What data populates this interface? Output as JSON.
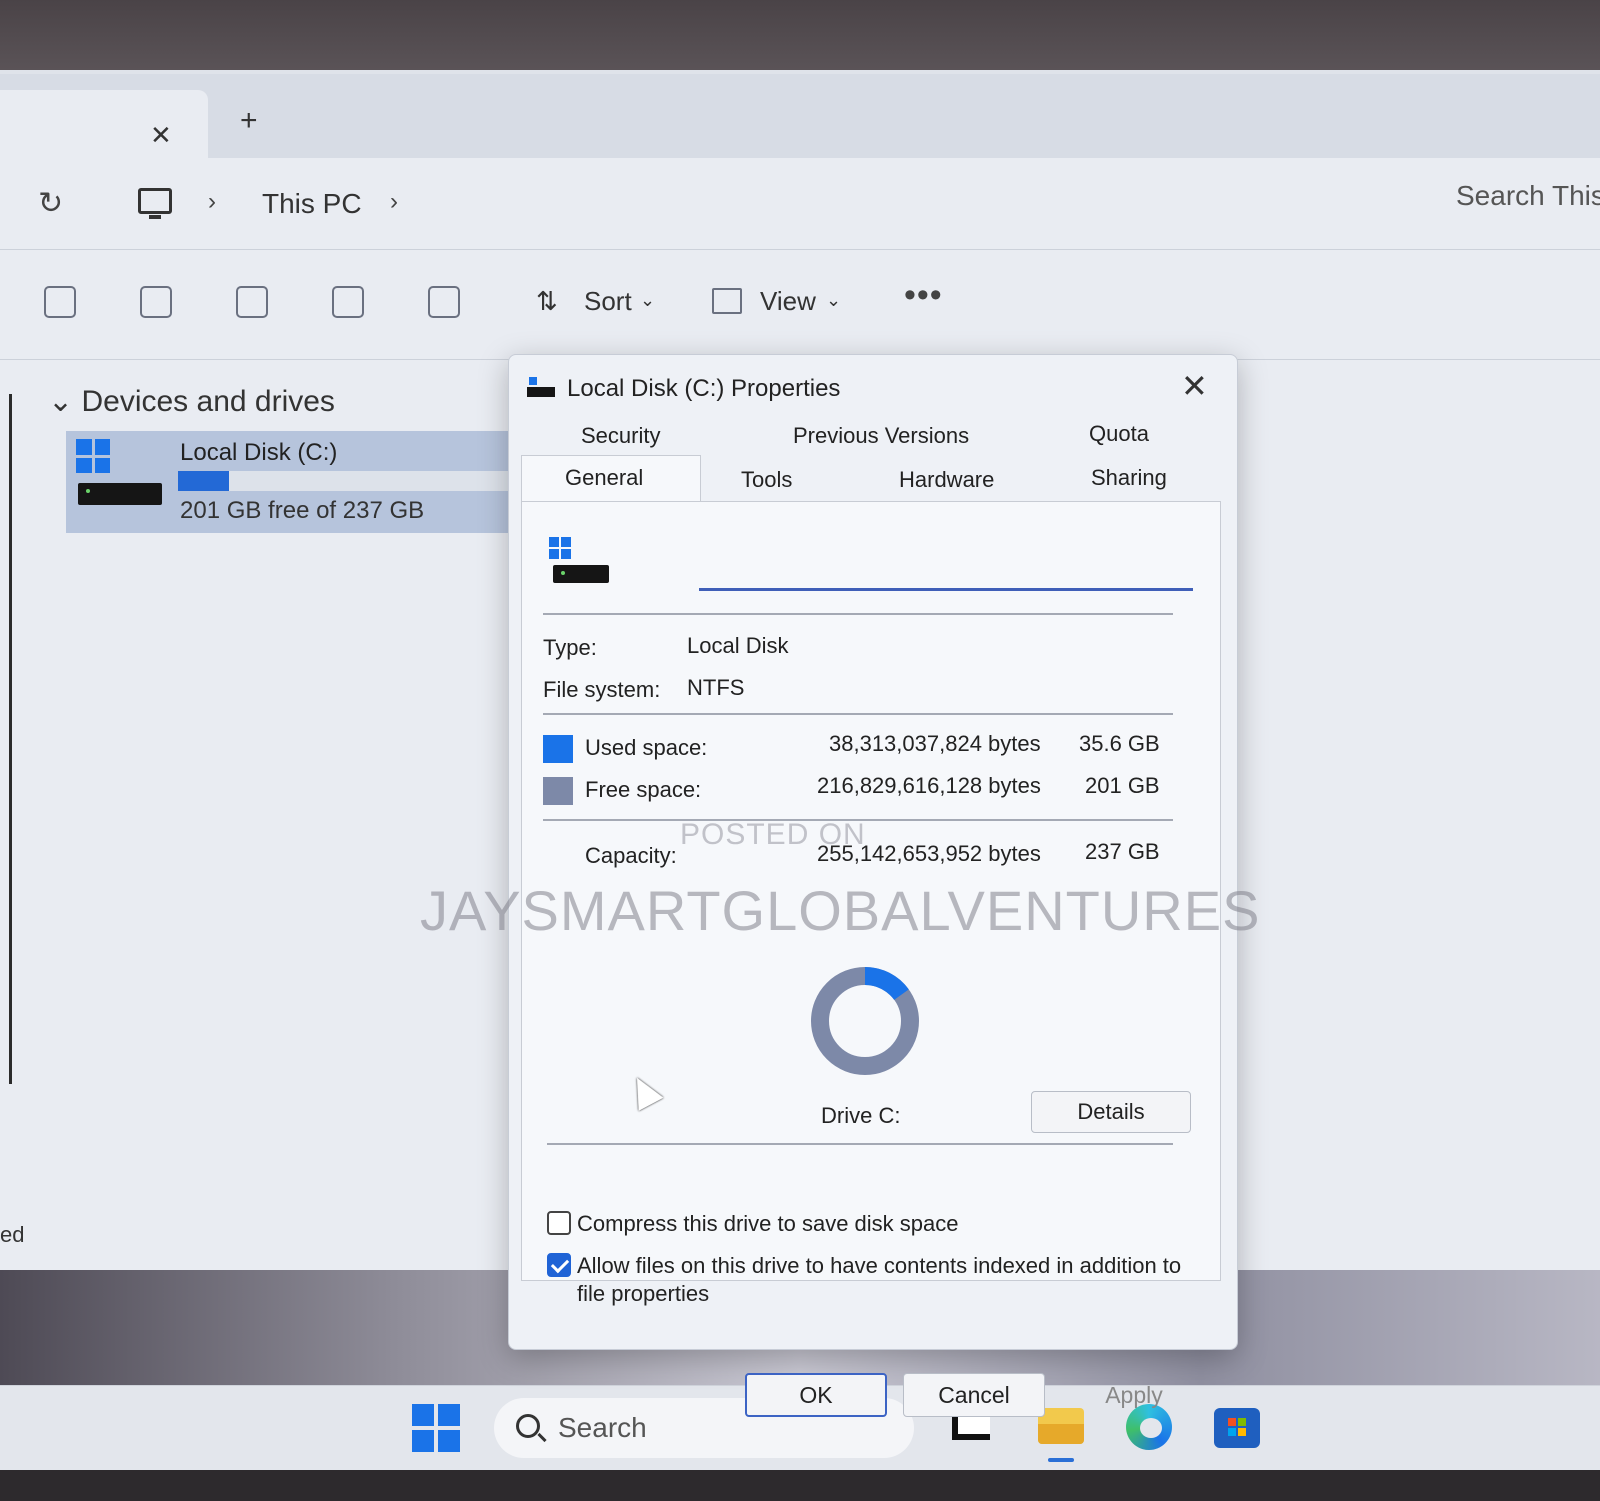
{
  "explorer": {
    "tab_close": "✕",
    "tab_add": "+",
    "breadcrumb": {
      "refresh_glyph": "↻",
      "sep": "›",
      "location": "This PC"
    },
    "search_placeholder": "Search This",
    "toolbar": {
      "sort_label": "Sort",
      "view_label": "View",
      "more_label": "•••",
      "sort_glyph": "⇅",
      "dropdown_glyph": "⌄"
    },
    "sidebar": {
      "section_title": "Devices and drives",
      "expand_glyph": "⌄",
      "drive": {
        "name": "Local Disk (C:)",
        "free_text": "201 GB free of 237 GB",
        "used_fraction": 0.15
      }
    },
    "truncated_text": "ed"
  },
  "dialog": {
    "title": "Local Disk (C:) Properties",
    "close_glyph": "✕",
    "tabs_row1": [
      "Security",
      "Previous Versions",
      "Quota"
    ],
    "tabs_row2": [
      "General",
      "Tools",
      "Hardware",
      "Sharing"
    ],
    "active_tab": "General",
    "volume_label_value": "",
    "type_label": "Type:",
    "type_value": "Local Disk",
    "fs_label": "File system:",
    "fs_value": "NTFS",
    "used": {
      "label": "Used space:",
      "bytes": "38,313,037,824 bytes",
      "size": "35.6 GB",
      "color": "#1a73e8"
    },
    "free": {
      "label": "Free space:",
      "bytes": "216,829,616,128 bytes",
      "size": "201 GB",
      "color": "#7d89a8"
    },
    "capacity": {
      "label": "Capacity:",
      "bytes": "255,142,653,952 bytes",
      "size": "237 GB"
    },
    "drive_caption": "Drive C:",
    "details_button": "Details",
    "compress": {
      "label": "Compress this drive to save disk space",
      "checked": false
    },
    "index": {
      "label_line1": "Allow files on this drive to have contents indexed in addition to",
      "label_line2": "file properties",
      "checked": true
    },
    "buttons": {
      "ok": "OK",
      "cancel": "Cancel",
      "apply": "Apply"
    }
  },
  "taskbar": {
    "search_placeholder": "Search"
  },
  "watermark": {
    "line1": "POSTED ON",
    "line2": "JAYSMARTGLOBALVENTURES"
  }
}
